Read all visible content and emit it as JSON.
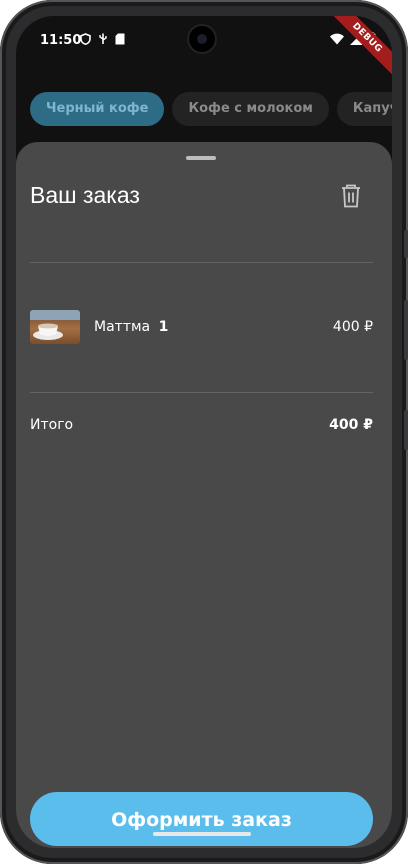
{
  "status_bar": {
    "time": "11:50"
  },
  "debug_banner": "DEBUG",
  "categories": [
    {
      "label": "Черный кофе",
      "active": true
    },
    {
      "label": "Кофе с молоком",
      "active": false
    },
    {
      "label": "Капуччино",
      "active": false
    }
  ],
  "cart": {
    "title": "Ваш заказ",
    "items": [
      {
        "name": "Маттма",
        "quantity": "1",
        "price": "400 ₽"
      }
    ],
    "total_label": "Итого",
    "total_value": "400 ₽",
    "submit_label": "Оформить заказ"
  },
  "colors": {
    "accent": "#5bbdec",
    "sheet": "#4a4949",
    "chip_active": "#2e6c86",
    "chip": "#232323"
  }
}
